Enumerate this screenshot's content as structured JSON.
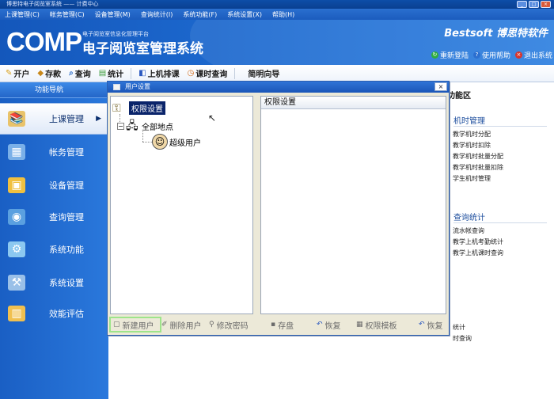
{
  "window": {
    "title": "博思特电子阅览室系统 —— 计费中心",
    "controls": [
      "_",
      "□",
      "×"
    ]
  },
  "menu": [
    "上课管理(C)",
    "帐务管理(C)",
    "设备管理(M)",
    "查询统计(I)",
    "系统功能(F)",
    "系统设置(X)",
    "帮助(H)"
  ],
  "banner": {
    "logo": "COMP",
    "subtitle": "电子阅览室信息化管理平台",
    "title": "电子阅览室管理系统",
    "brand": "Bestsoft 博思特软件",
    "links": [
      {
        "label": "重新登陆",
        "icon": "refresh-icon",
        "color": "#2fae3f"
      },
      {
        "label": "使用帮助",
        "icon": "help-icon",
        "color": "#2c6fd0"
      },
      {
        "label": "退出系统",
        "icon": "exit-icon",
        "color": "#d9342b"
      }
    ]
  },
  "toolbar": {
    "items": [
      {
        "label": "开户",
        "icon": "open-account-icon"
      },
      {
        "label": "存款",
        "icon": "deposit-icon"
      },
      {
        "label": "查询",
        "icon": "query-icon"
      },
      {
        "label": "统计",
        "icon": "statistics-icon"
      },
      {
        "label": "上机排课",
        "icon": "schedule-icon"
      },
      {
        "label": "课时查询",
        "icon": "class-hours-icon"
      },
      {
        "label": "简明向导",
        "icon": ""
      }
    ]
  },
  "sidebar": {
    "header": "功能导航",
    "items": [
      {
        "label": "上课管理",
        "icon": "book-icon",
        "active": true
      },
      {
        "label": "帐务管理",
        "icon": "ledger-icon",
        "active": false
      },
      {
        "label": "设备管理",
        "icon": "device-icon",
        "active": false
      },
      {
        "label": "查询管理",
        "icon": "search-user-icon",
        "active": false
      },
      {
        "label": "系统功能",
        "icon": "gear-icon",
        "active": false
      },
      {
        "label": "系统设置",
        "icon": "settings-icon",
        "active": false
      },
      {
        "label": "效能评估",
        "icon": "chart-icon",
        "active": false
      }
    ]
  },
  "right_panel": {
    "title": "功能区",
    "groups": [
      {
        "label": "机时管理",
        "items": [
          "教学机时分配",
          "教学机时扣除",
          "教学机时批量分配",
          "教学机时批量扣除",
          "学生机时管理"
        ]
      },
      {
        "label": "查询统计",
        "items": [
          "流水帐查询",
          "教学上机考勤统计",
          "教学上机课时查询"
        ]
      }
    ],
    "footer_items": [
      "统计",
      "时查询"
    ]
  },
  "dialog": {
    "title": "用户设置",
    "close": "×",
    "tree": {
      "root": "权限设置",
      "node": "全部地点",
      "leaf": "超级用户"
    },
    "perm_header": "权限设置",
    "buttons": [
      {
        "label": "新建用户",
        "icon": "new-user-icon"
      },
      {
        "label": "删除用户",
        "icon": "delete-user-icon"
      },
      {
        "label": "修改密码",
        "icon": "change-password-icon"
      },
      {
        "label": "存盘",
        "icon": "save-icon"
      },
      {
        "label": "恢复",
        "icon": "restore-icon"
      },
      {
        "label": "权限模板",
        "icon": "template-icon"
      },
      {
        "label": "恢复",
        "icon": "restore-icon"
      }
    ]
  }
}
